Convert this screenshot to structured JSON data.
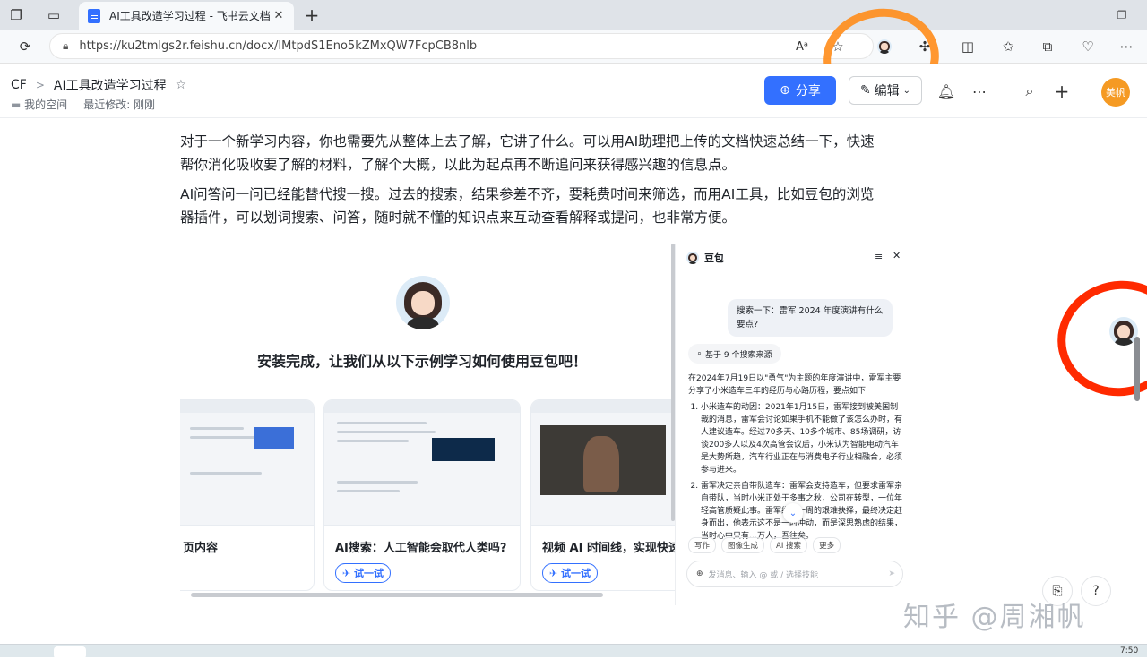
{
  "browser": {
    "tab_title": "AI工具改造学习过程 - 飞书云文档",
    "tab_close": "✕",
    "new_tab": "+",
    "url": "https://ku2tmlgs2r.feishu.cn/docx/IMtpdS1Eno5kZMxQW7FcpCB8nlb",
    "icons": [
      "tab-actions-icon",
      "tab-groups-icon",
      "refresh-icon",
      "lock-icon",
      "read-aloud-icon",
      "favorite-star-icon",
      "profile-icon",
      "extensions-icon",
      "split-screen-icon",
      "favorites-icon",
      "collections-icon",
      "performance-icon",
      "more-icon"
    ]
  },
  "doc_header": {
    "breadcrumb_root": "CF",
    "breadcrumb_sep": ">",
    "doc_title": "AI工具改造学习过程",
    "space": "我的空间",
    "last_modified": "最近修改: 刚刚",
    "share_label": "分享",
    "edit_label": "编辑",
    "user_initials": "美帆",
    "accent": "#3370ff"
  },
  "content": {
    "paragraph1_line1": "对于一个新学习内容，你也需要先从整体上去了解，它讲了什么。可以用AI助理把上传的文档快速总结一下，快速",
    "paragraph1_line2": "帮你消化吸收要了解的材料，了解个大概，以此为起点再不断追问来获得感兴趣的信息点。",
    "paragraph2_line1": "AI问答问一问已经能替代搜一搜。过去的搜索，结果参差不齐，要耗费时间来筛选，而用AI工具，比如豆包的浏览",
    "paragraph2_line2": "器插件，可以划词搜索、问答，随时就不懂的知识点来互动查看解释或提问，也非常方便。"
  },
  "embed": {
    "welcome_heading": "安装完成，让我们从以下示例学习如何使用豆包吧！",
    "cards": [
      {
        "title": "页内容",
        "try": ""
      },
      {
        "title": "AI搜索：人工智能会取代人类吗?",
        "try": "✈ 试一试"
      },
      {
        "title": "视频 AI 时间线，实现快速",
        "try": "✈ 试一试"
      }
    ],
    "doubao": {
      "name": "豆包",
      "question": "搜索一下：雷军 2024 年度演讲有什么要点?",
      "sources": "基于 9 个搜索来源",
      "intro": "在2024年7月19日以\"勇气\"为主题的年度演讲中，雷军主要分享了小米造车三年的经历与心路历程，要点如下:",
      "points": [
        "小米造车的动因：2021年1月15日，雷军接到被美国制裁的消息，雷军会讨论如果手机不能做了该怎么办时，有人建议造车。经过70多天、10多个城市、85场调研，访谈200多人以及4次高管会议后，小米认为智能电动汽车是大势所趋，汽车行业正在与消费电子行业相融合，必须参与进来。",
        "雷军决定亲自带队造车：雷军会支持造车，但要求雷军亲自带队，当时小米正处于多事之秋，公司在转型，一位年轻高管质疑此事。雷军经过一周的艰难抉择，最终决定赶身而出，他表示这不是一时冲动，而是深思熟虑的结果，当时心中只有…万人，吾往矣。"
      ],
      "tools": [
        "写作",
        "图像生成",
        "AI 搜索",
        "更多"
      ],
      "input_placeholder": "发消息、输入 @ 或 / 选择技能"
    }
  },
  "watermark": "知乎 @周湘帆",
  "clock": "7:50",
  "annotation_color": "#ff2a00",
  "annotation_orange": "#ff8c1a"
}
